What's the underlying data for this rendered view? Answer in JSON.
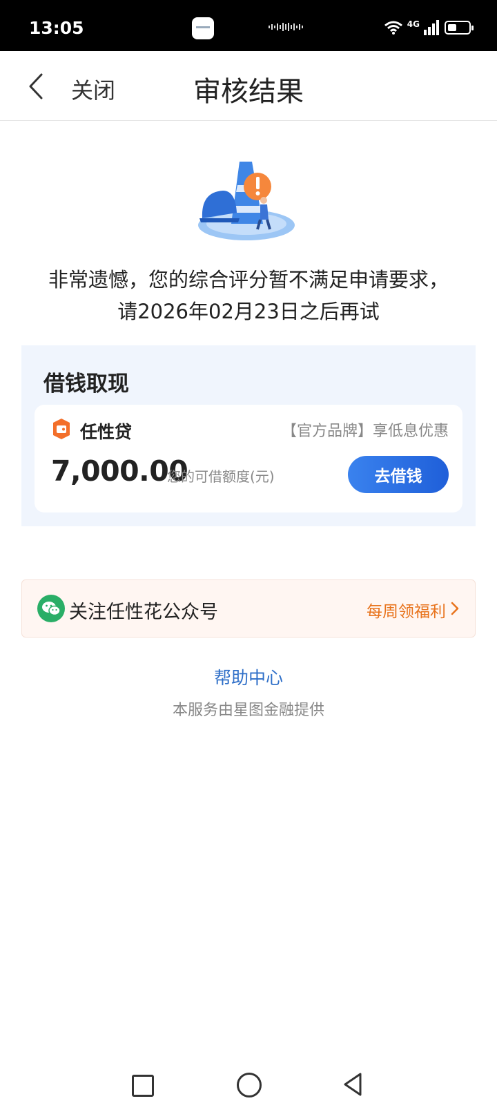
{
  "status_bar": {
    "time": "13:05",
    "network": "4G",
    "icons": [
      "app-icon",
      "sound-wave-icon",
      "wifi-icon",
      "signal-icon",
      "battery-icon"
    ]
  },
  "header": {
    "close_label": "关闭",
    "title": "审核结果"
  },
  "result": {
    "illustration": "traffic-cone-warning-illustration",
    "message_line1": "非常遗憾，您的综合评分暂不满足申请要求，",
    "message_line2": "请2026年02月23日之后再试"
  },
  "loan_section": {
    "title": "借钱取现",
    "product_name": "任性贷",
    "product_tag": "【官方品牌】享低息优惠",
    "amount": "7,000.00",
    "amount_label": "您的可借额度(元)",
    "button_label": "去借钱"
  },
  "wechat_banner": {
    "text": "关注任性花公众号",
    "benefit": "每周领福利"
  },
  "help": {
    "link_label": "帮助中心",
    "note": "本服务由星图金融提供"
  },
  "colors": {
    "accent_blue": "#1f5fd9",
    "warning_orange": "#e8731c",
    "wechat_green": "#2aae67",
    "section_bg": "#f0f5fd"
  }
}
